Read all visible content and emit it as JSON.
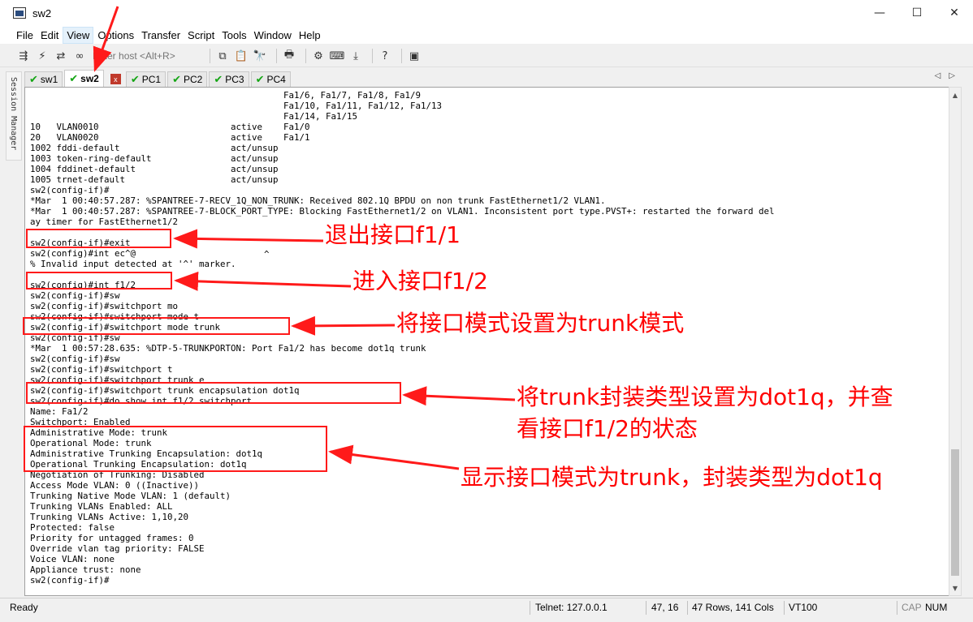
{
  "window": {
    "title": "sw2",
    "minimize": "—",
    "maximize": "☐",
    "close": "✕"
  },
  "menu": {
    "items": [
      "File",
      "Edit",
      "View",
      "Options",
      "Transfer",
      "Script",
      "Tools",
      "Window",
      "Help"
    ]
  },
  "toolbar": {
    "host_placeholder": "Enter host <Alt+R>"
  },
  "session_manager": {
    "label": "Session Manager"
  },
  "tabs": [
    {
      "label": "sw1",
      "active": false
    },
    {
      "label": "sw2",
      "active": true
    },
    {
      "label": "PC1",
      "active": false
    },
    {
      "label": "PC2",
      "active": false
    },
    {
      "label": "PC3",
      "active": false
    },
    {
      "label": "PC4",
      "active": false
    }
  ],
  "tab_close": "x",
  "terminal": {
    "lines": [
      "                                                Fa1/6, Fa1/7, Fa1/8, Fa1/9",
      "                                                Fa1/10, Fa1/11, Fa1/12, Fa1/13",
      "                                                Fa1/14, Fa1/15",
      "10   VLAN0010                         active    Fa1/0",
      "20   VLAN0020                         active    Fa1/1",
      "1002 fddi-default                     act/unsup",
      "1003 token-ring-default               act/unsup",
      "1004 fddinet-default                  act/unsup",
      "1005 trnet-default                    act/unsup",
      "sw2(config-if)#",
      "*Mar  1 00:40:57.287: %SPANTREE-7-RECV_1Q_NON_TRUNK: Received 802.1Q BPDU on non trunk FastEthernet1/2 VLAN1.",
      "*Mar  1 00:40:57.287: %SPANTREE-7-BLOCK_PORT_TYPE: Blocking FastEthernet1/2 on VLAN1. Inconsistent port type.PVST+: restarted the forward del",
      "ay timer for FastEthernet1/2",
      "",
      "sw2(config-if)#exit",
      "sw2(config)#int ec^@",
      "% Invalid input detected at '^' marker.",
      "",
      "sw2(config)#int f1/2",
      "sw2(config-if)#sw",
      "sw2(config-if)#switchport mo",
      "sw2(config-if)#switchport mode t",
      "sw2(config-if)#switchport mode trunk",
      "sw2(config-if)#sw",
      "*Mar  1 00:57:28.635: %DTP-5-TRUNKPORTON: Port Fa1/2 has become dot1q trunk",
      "sw2(config-if)#sw",
      "sw2(config-if)#switchport t",
      "sw2(config-if)#switchport trunk e",
      "sw2(config-if)#switchport trunk encapsulation dot1q",
      "sw2(config-if)#do show int f1/2 switchport",
      "Name: Fa1/2",
      "Switchport: Enabled",
      "Administrative Mode: trunk",
      "Operational Mode: trunk",
      "Administrative Trunking Encapsulation: dot1q",
      "Operational Trunking Encapsulation: dot1q",
      "Negotiation of Trunking: Disabled",
      "Access Mode VLAN: 0 ((Inactive))",
      "Trunking Native Mode VLAN: 1 (default)",
      "Trunking VLANs Enabled: ALL",
      "Trunking VLANs Active: 1,10,20",
      "Protected: false",
      "Priority for untagged frames: 0",
      "Override vlan tag priority: FALSE",
      "Voice VLAN: none",
      "Appliance trust: none",
      "sw2(config-if)#"
    ],
    "cursor_marker": "^"
  },
  "annotations": {
    "exit": "退出接口f1/1",
    "enter": "进入接口f1/2",
    "mode": "将接口模式设置为trunk模式",
    "encap_line1": "将trunk封装类型设置为dot1q，并查",
    "encap_line2": "看接口f1/2的状态",
    "result": "显示接口模式为trunk，封装类型为dot1q",
    "color": "#ff0000"
  },
  "status": {
    "ready": "Ready",
    "connection": "Telnet: 127.0.0.1",
    "cursor": "47,  16",
    "size": "47 Rows, 141 Cols",
    "emulation": "VT100",
    "cap": "CAP",
    "num": "NUM"
  }
}
